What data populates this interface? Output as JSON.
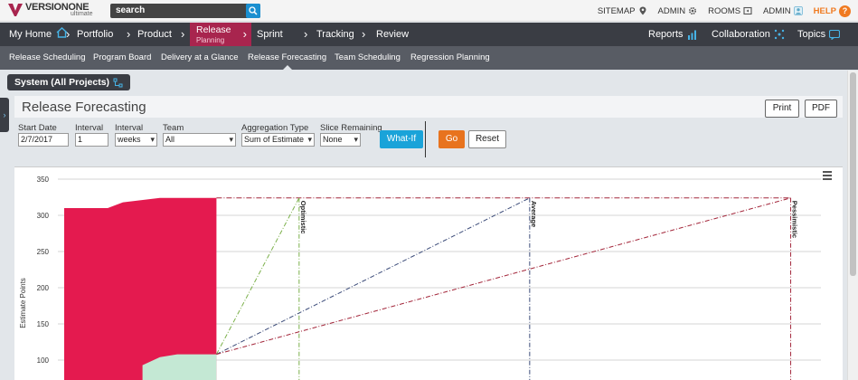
{
  "topbar": {
    "logo_text": "VERSIONONE",
    "logo_sub": "ultimate",
    "search_text": "search",
    "links": [
      {
        "label": "SITEMAP",
        "icon": "location-icon"
      },
      {
        "label": "ADMIN",
        "icon": "gear-icon"
      },
      {
        "label": "ROOMS",
        "icon": "rooms-icon"
      },
      {
        "label": "ADMIN",
        "icon": "user-icon"
      }
    ],
    "help_label": "HELP",
    "help_icon_text": "?"
  },
  "nav": {
    "items": [
      "My Home",
      "Portfolio",
      "Product",
      "Release",
      "Sprint",
      "Tracking",
      "Review"
    ],
    "active_sub": "Planning",
    "right": [
      "Reports",
      "Collaboration",
      "Topics"
    ]
  },
  "subnav": {
    "items": [
      "Release Scheduling",
      "Program Board",
      "Delivery at a Glance",
      "Release Forecasting",
      "Team Scheduling",
      "Regression Planning"
    ],
    "active_index": 3
  },
  "project": {
    "label": "System (All Projects)"
  },
  "panel": {
    "title": "Release Forecasting",
    "print_label": "Print",
    "pdf_label": "PDF"
  },
  "filters": {
    "start_date_label": "Start Date",
    "start_date_value": "2/7/2017",
    "interval_label": "Interval",
    "interval_value": "1",
    "interval_unit_label": "Interval",
    "interval_unit_value": "weeks",
    "team_label": "Team",
    "team_value": "All",
    "aggregation_label": "Aggregation Type",
    "aggregation_value": "Sum of Estimate",
    "slice_label": "Slice Remaining",
    "slice_value": "None",
    "whatif_label": "What-If",
    "go_label": "Go",
    "reset_label": "Reset"
  },
  "colors": {
    "nav_bg": "#3a3d44",
    "subnav_bg": "#585c64",
    "active_nav": "#a8254e",
    "whatif": "#1aa3d9",
    "go": "#e8731e",
    "bar_red": "#e41a4f",
    "bar_green": "#c4e8d4",
    "optimistic": "#7bb04a",
    "average": "#3a4a78",
    "pessimistic": "#a4283c"
  },
  "chart_data": {
    "type": "area",
    "ylabel": "Estimate Points",
    "ylim": [
      100,
      350
    ],
    "yticks": [
      350,
      300,
      250,
      200,
      150,
      100
    ],
    "series": [
      {
        "name": "",
        "color": "#e41a4f",
        "points": [
          [
            0,
            310
          ],
          [
            1,
            310
          ],
          [
            1.35,
            318
          ],
          [
            2.2,
            324
          ],
          [
            3.5,
            324
          ]
        ]
      },
      {
        "name": "",
        "color": "#c4e8d4",
        "points": [
          [
            1.8,
            93
          ],
          [
            2.2,
            104
          ],
          [
            2.6,
            108
          ],
          [
            3.5,
            108
          ]
        ]
      }
    ],
    "forecast": {
      "start": [
        3.5,
        108
      ],
      "end_y": 324,
      "lines": [
        {
          "label": "Optimistic",
          "x_end": 5.4,
          "color": "#7bb04a"
        },
        {
          "label": "Average",
          "x_end": 10.7,
          "color": "#3a4a78"
        },
        {
          "label": "Pessimistic",
          "x_end": 16.7,
          "color": "#a4283c"
        }
      ]
    },
    "xlim": [
      0,
      17
    ]
  }
}
